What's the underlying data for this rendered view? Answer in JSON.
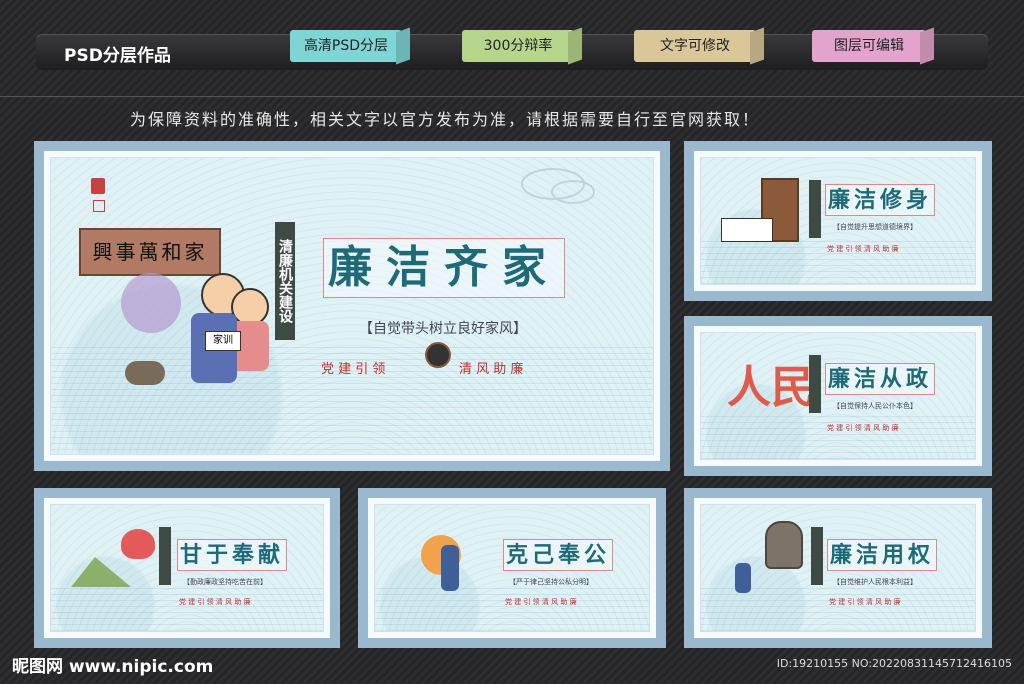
{
  "header": {
    "title": "PSD分层作品",
    "tabs": [
      {
        "label": "高清PSD分层",
        "color": "#7fd4d6"
      },
      {
        "label": "300分辩率",
        "color": "#b6d58c"
      },
      {
        "label": "文字可修改",
        "color": "#d9c699"
      },
      {
        "label": "图层可编辑",
        "color": "#e2a4cc"
      }
    ]
  },
  "notice": "为保障资料的准确性，相关文字以官方发布为准，请根据需要自行至官网获取！",
  "main_board": {
    "title": "廉洁齐家",
    "vertical": "清廉机关建设",
    "subtitle": "【自觉带头树立良好家风】",
    "slogan_left": "党 建 引 领",
    "slogan_right": "清 风 助 廉",
    "plaque": "興事萬和家",
    "book": "家训"
  },
  "boards": [
    {
      "title": "廉洁修身",
      "subtitle": "【自觉提升思想道德境界】",
      "slogan": "党 建 引 领 清 风 助 廉"
    },
    {
      "title": "廉洁从政",
      "subtitle": "【自觉保持人民公仆本色】",
      "slogan": "党 建 引 领 清 风 助 廉",
      "figure": "人民"
    },
    {
      "title": "甘于奉献",
      "subtitle": "【勤政廉政坚持吃苦在前】",
      "slogan": "党 建 引 领 清 风 助 廉"
    },
    {
      "title": "克己奉公",
      "subtitle": "【严于律己坚持公私分明】",
      "slogan": "党 建 引 领 清 风 助 廉"
    },
    {
      "title": "廉洁用权",
      "subtitle": "【自觉维护人民根本利益】",
      "slogan": "党 建 引 领 清 风 助 廉"
    }
  ],
  "footer": {
    "logo": "昵图网 www.nipic.com",
    "id": "ID:19210155 NO:20220831145712416105"
  }
}
